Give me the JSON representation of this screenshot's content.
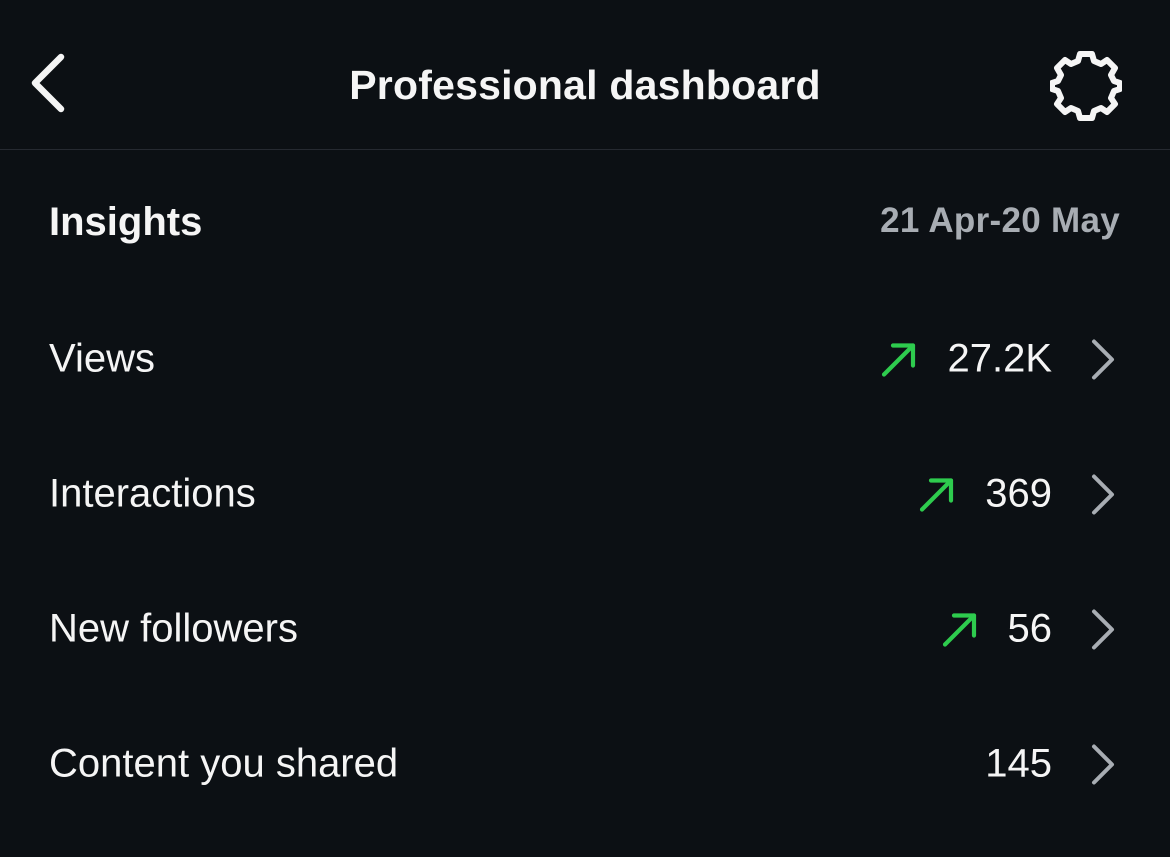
{
  "header": {
    "title": "Professional dashboard",
    "back_icon": "chevron-left-icon",
    "settings_icon": "gear-icon"
  },
  "insights": {
    "title": "Insights",
    "date_range": "21 Apr-20 May"
  },
  "metrics": [
    {
      "label": "Views",
      "value": "27.2K",
      "trend": "up"
    },
    {
      "label": "Interactions",
      "value": "369",
      "trend": "up"
    },
    {
      "label": "New followers",
      "value": "56",
      "trend": "up"
    },
    {
      "label": "Content you shared",
      "value": "145",
      "trend": "none"
    }
  ],
  "colors": {
    "background": "#0c1014",
    "text": "#f5f5f5",
    "muted": "#a8adb3",
    "trend_up": "#2ecc4e",
    "chevron": "#a8adb3",
    "divider": "#262a31"
  }
}
